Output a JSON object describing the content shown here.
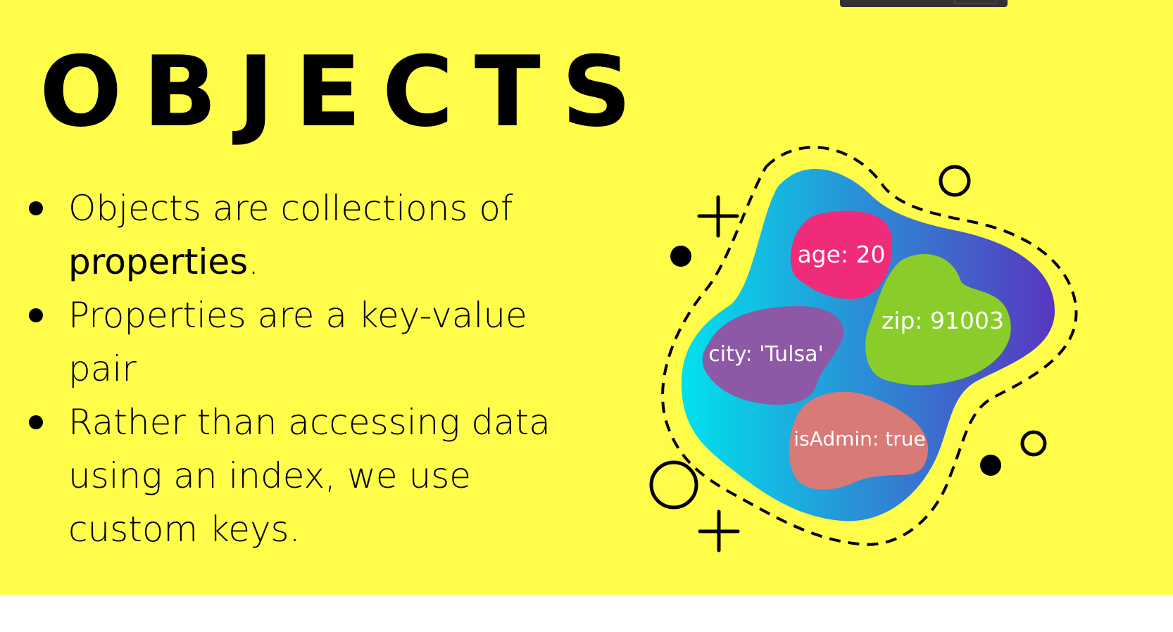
{
  "slide": {
    "title": "OBJECTS",
    "bullets": [
      {
        "text": "Objects are collections of ",
        "emphasis": "properties",
        "suffix": "."
      },
      {
        "text": "Properties are a key-value pair",
        "emphasis": "",
        "suffix": ""
      },
      {
        "text": "Rather than accessing data using an index, we use custom keys.",
        "emphasis": "",
        "suffix": ""
      }
    ]
  },
  "illustration": {
    "gradient_start": "#00e2ec",
    "gradient_end": "#5836bf",
    "properties": [
      {
        "label": "age: 20",
        "color": "#ef2b7a"
      },
      {
        "label": "zip: 91003",
        "color": "#8acd2a"
      },
      {
        "label": "city: 'Tulsa'",
        "color": "#8d58a6"
      },
      {
        "label": "isAdmin: true",
        "color": "#d87a76"
      }
    ],
    "decorations": [
      "plus-icon",
      "plus-icon",
      "circle-outline-icon",
      "circle-outline-icon",
      "circle-outline-icon",
      "dot-icon",
      "dot-icon"
    ]
  }
}
